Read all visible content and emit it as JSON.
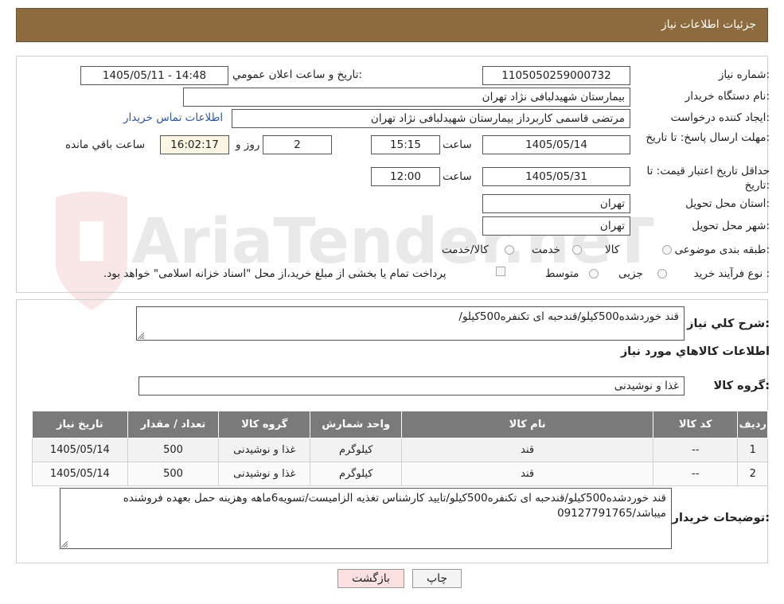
{
  "header": {
    "title": "جزئیات اطلاعات نیاز"
  },
  "fields": {
    "need_number_label": "شماره نیاز:",
    "need_number": "1105050259000732",
    "announce_label": "تاریخ و ساعت اعلان عمومي:",
    "announce_value": "1405/05/11 - 14:48",
    "buyer_org_label": "نام دستگاه خريدار:",
    "buyer_org": "بیمارستان شهیدلبافی نژاد تهران",
    "creator_label": "ایجاد کننده درخواست:",
    "creator": "مرتضی  قاسمی کاربرداز بیمارستان شهیدلبافی نژاد تهران",
    "contact_link": "اطلاعات تماس خریدار",
    "reply_deadline_label": "مهلت ارسال پاسخ: تا تاریخ:",
    "reply_date": "1405/05/14",
    "time_label": "ساعت",
    "reply_time": "15:15",
    "days_value": "2",
    "days_label": "روز و",
    "remaining_time": "16:02:17",
    "remaining_label": "ساعت باقي مانده",
    "price_validity_label": "حداقل تاریخ اعتبار قیمت: تا تاریخ:",
    "validity_date": "1405/05/31",
    "validity_time_label": "ساعت",
    "validity_time": "12:00",
    "province_label": "استان محل تحویل:",
    "province": "تهران",
    "city_label": "شهر محل تحویل:",
    "city": "تهران",
    "category_label": "طبقه بندی موضوعی:",
    "category_options": [
      "کالا",
      "خدمت",
      "کالا/خدمت"
    ],
    "purchase_type_label": "نوع فرآیند خرید :",
    "purchase_options": [
      "جزیی",
      "متوسط"
    ],
    "payment_note": "پرداخت تمام یا بخشی از مبلغ خرید،از محل \"اسناد خزانه اسلامی\" خواهد بود."
  },
  "summary": {
    "label": "شرح کلي نياز:",
    "value": "قند خوردشده500کیلو/قندحبه ای تکنفره500کیلو/"
  },
  "goods": {
    "title": "اطلاعات کالاهاي مورد نياز",
    "group_label": "گروه کالا:",
    "group_value": "غذا و نوشیدنی",
    "columns": [
      "ردیف",
      "کد کالا",
      "نام کالا",
      "واحد شمارش",
      "گروه کالا",
      "تعداد / مقدار",
      "تاریخ نیاز"
    ],
    "rows": [
      [
        "1",
        "--",
        "قند",
        "کیلوگرم",
        "غذا و نوشیدنی",
        "500",
        "1405/05/14"
      ],
      [
        "2",
        "--",
        "قند",
        "کیلوگرم",
        "غذا و نوشیدنی",
        "500",
        "1405/05/14"
      ]
    ]
  },
  "buyer_notes": {
    "label": "توضیحات خریدار:",
    "value": "قند خوردشده500کیلو/قندحبه ای تکنفره500کیلو/تایید کارشناس تغذیه الزامیست/تسویه6ماهه وهزینه حمل بعهده فروشنده میباشد/09127791765"
  },
  "buttons": {
    "print": "چاپ",
    "back": "بازگشت"
  },
  "watermark": {
    "text": "AriaTender.neT"
  },
  "colors": {
    "header_bg": "#8d6b3e",
    "table_header_bg": "#7a7a7a",
    "link": "#2b56b0",
    "back_button_bg": "#fde0e0"
  }
}
